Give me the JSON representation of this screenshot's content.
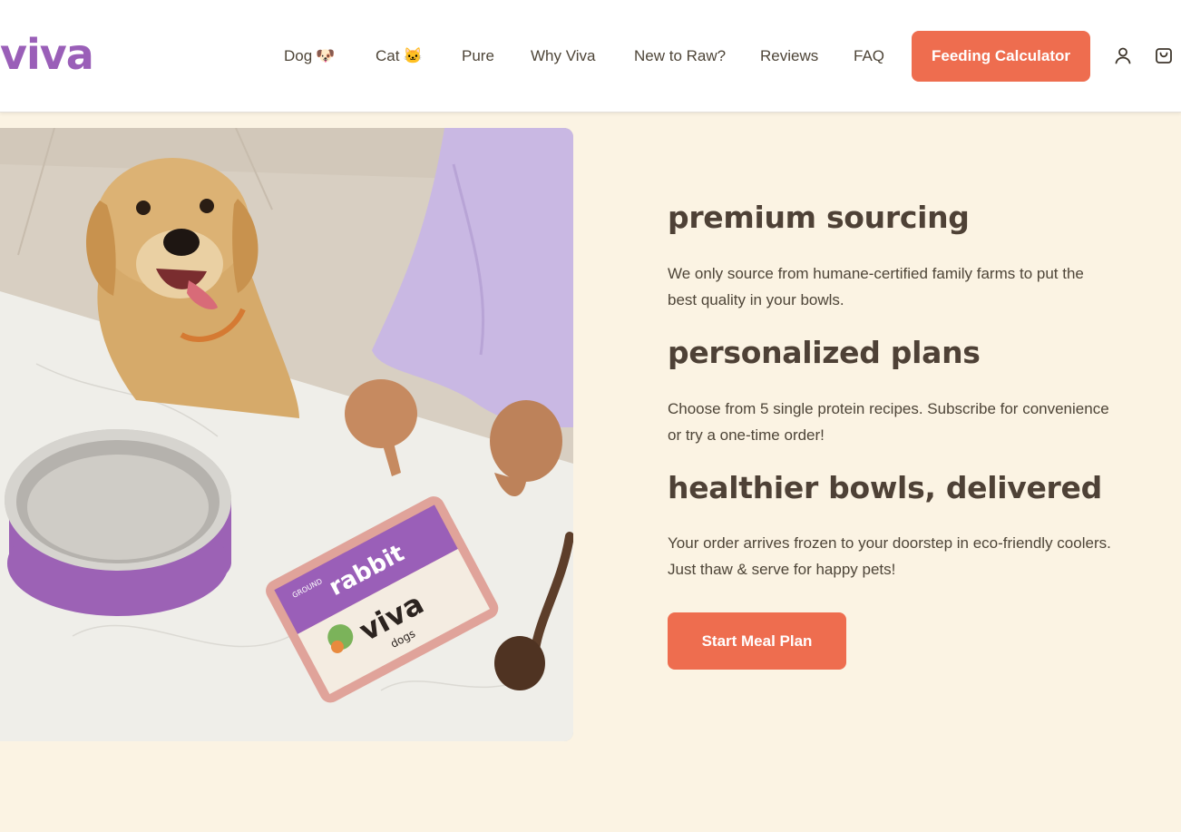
{
  "brand": {
    "logo_text": "viva",
    "logo_color": "#9a5fb8"
  },
  "nav": {
    "items": [
      {
        "label": "Dog",
        "emoji": "🐶"
      },
      {
        "label": "Cat",
        "emoji": "🐱"
      },
      {
        "label": "Pure",
        "emoji": ""
      },
      {
        "label": "Why Viva",
        "emoji": ""
      },
      {
        "label": "New to Raw?",
        "emoji": ""
      },
      {
        "label": "Reviews",
        "emoji": ""
      },
      {
        "label": "FAQ",
        "emoji": ""
      }
    ],
    "cta_label": "Feeding Calculator",
    "account_icon": "user-icon",
    "cart_icon": "shopping-bag-icon"
  },
  "hero_image": {
    "package_brand": "viva",
    "package_sub": "dogs",
    "package_flavor": "rabbit",
    "package_prefix": "GROUND"
  },
  "features": [
    {
      "title": "premium sourcing",
      "text": "We only source from humane-certified family farms to put the best quality in your bowls."
    },
    {
      "title": "personalized plans",
      "text": "Choose from 5 single protein recipes. Subscribe for convenience or try a one-time order!"
    },
    {
      "title": "healthier bowls, delivered",
      "text": "Your order arrives frozen to your doorstep in eco-friendly coolers. Just thaw & serve for happy pets!"
    }
  ],
  "cta_main_label": "Start Meal Plan",
  "colors": {
    "accent": "#ee6d4f",
    "background": "#fbf3e3",
    "heading": "#4e4136",
    "brand_purple": "#9a5fb8"
  }
}
